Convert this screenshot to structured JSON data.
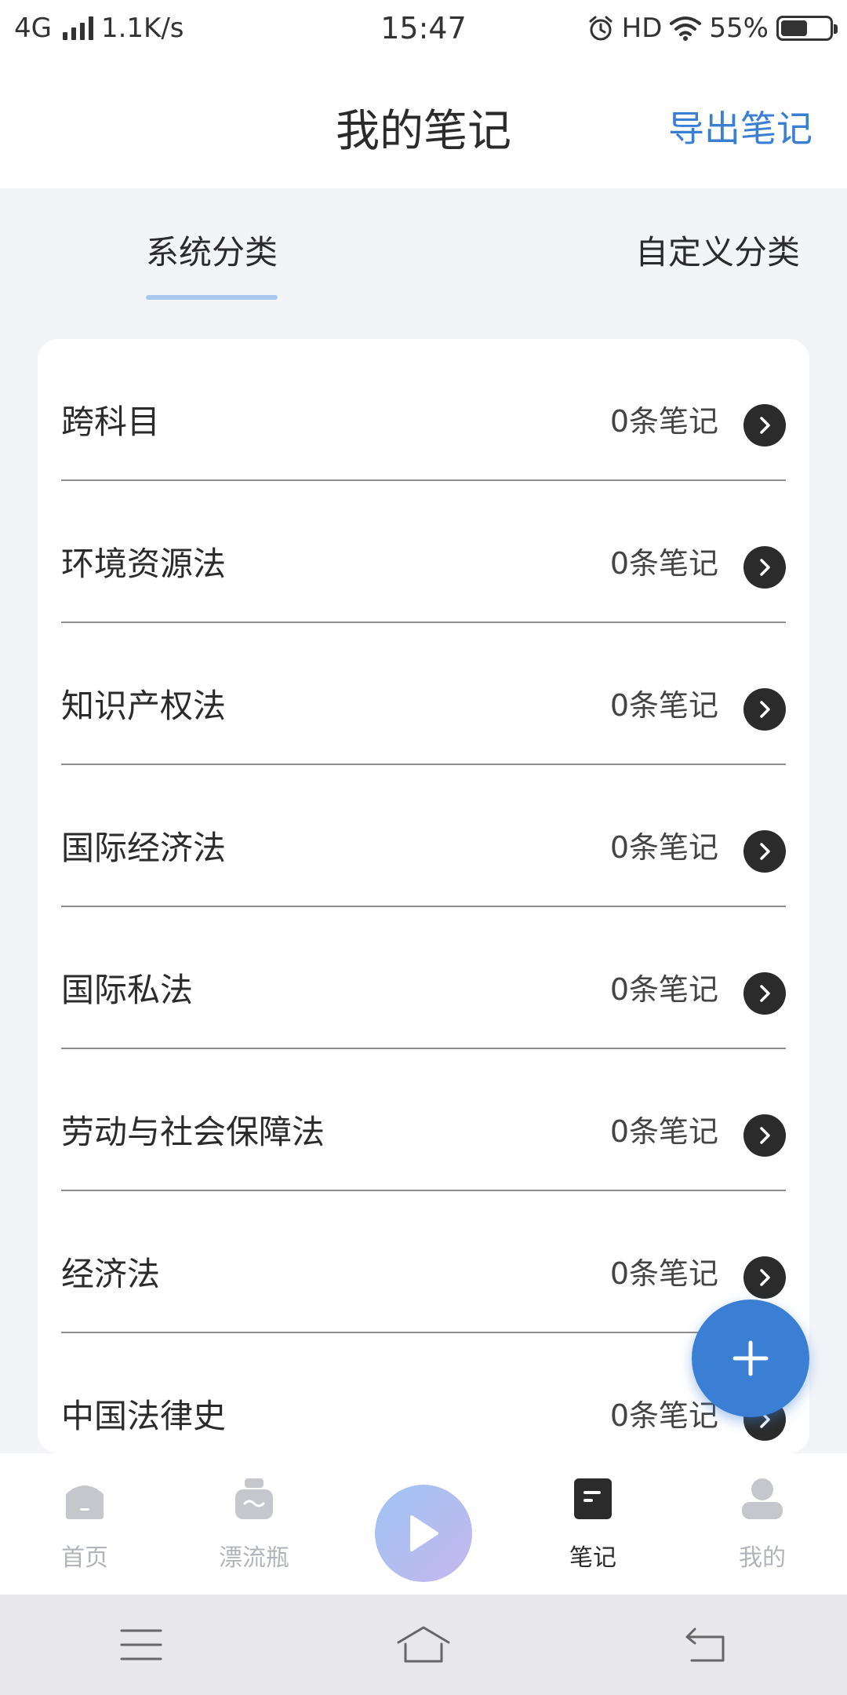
{
  "status_bar": {
    "network": "4G",
    "speed": "1.1K/s",
    "time": "15:47",
    "hd": "HD",
    "battery_percent_text": "55%",
    "battery_level": 0.55
  },
  "header": {
    "title": "我的笔记",
    "export_label": "导出笔记"
  },
  "tabs": {
    "system": "系统分类",
    "custom": "自定义分类",
    "active": "system"
  },
  "categories": [
    {
      "title": "跨科目",
      "count": "0条笔记"
    },
    {
      "title": "环境资源法",
      "count": "0条笔记"
    },
    {
      "title": "知识产权法",
      "count": "0条笔记"
    },
    {
      "title": "国际经济法",
      "count": "0条笔记"
    },
    {
      "title": "国际私法",
      "count": "0条笔记"
    },
    {
      "title": "劳动与社会保障法",
      "count": "0条笔记"
    },
    {
      "title": "经济法",
      "count": "0条笔记"
    },
    {
      "title": "中国法律史",
      "count": "0条笔记"
    }
  ],
  "bottom_nav": {
    "home": "首页",
    "bottle": "漂流瓶",
    "notes": "笔记",
    "mine": "我的"
  },
  "colors": {
    "accent": "#3b7fd4",
    "tab_underline": "#a9c8ef",
    "inactive_nav": "#b2b4bb"
  }
}
